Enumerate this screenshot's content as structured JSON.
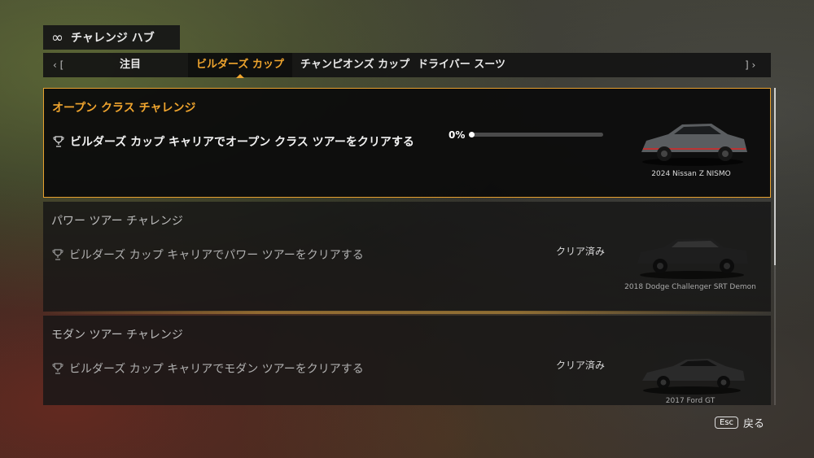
{
  "hub": {
    "icon": "infinity-icon",
    "title": "チャレンジ ハブ"
  },
  "tabs": {
    "prev_icon": "‹ [",
    "next_icon": "] ›",
    "items": [
      {
        "label": "注目"
      },
      {
        "label": "ビルダーズ カップ",
        "active": true
      },
      {
        "label": "チャンピオンズ カップ"
      },
      {
        "label": "ドライバー スーツ"
      }
    ]
  },
  "cards": [
    {
      "title": "オープン クラス チャレンジ",
      "description": "ビルダーズ カップ キャリアでオープン クラス ツアーをクリアする",
      "progress_label": "0%",
      "progress": 0,
      "car_name": "2024 Nissan Z NISMO",
      "selected": true
    },
    {
      "title": "パワー ツアー チャレンジ",
      "description": "ビルダーズ カップ キャリアでパワー ツアーをクリアする",
      "status": "クリア済み",
      "car_name": "2018 Dodge Challenger SRT Demon"
    },
    {
      "title": "モダン ツアー チャレンジ",
      "description": "ビルダーズ カップ キャリアでモダン ツアーをクリアする",
      "status": "クリア済み",
      "car_name": "2017 Ford GT"
    }
  ],
  "footer": {
    "key": "Esc",
    "label": "戻る"
  },
  "colors": {
    "accent": "#f0a52e",
    "panel": "#161616"
  }
}
